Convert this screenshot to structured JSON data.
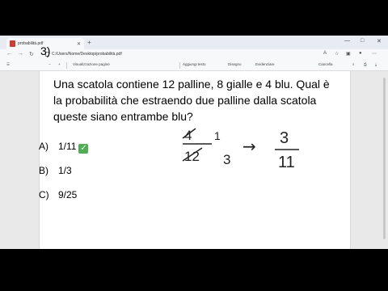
{
  "browser": {
    "tab_title": "probabilità.pdf",
    "url": "C:/Users/Nome/Desktop/probabilità.pdf",
    "window_controls": [
      "—",
      "□",
      "✕"
    ]
  },
  "pdf_toolbar": {
    "items": [
      "Visualizzazione pagine",
      "Aggiungi testo",
      "Disegno",
      "Evidenziare",
      "Cancella"
    ]
  },
  "question": {
    "number": "3)",
    "lines": [
      "Una scatola contiene 12 palline, 8 gialle e 4 blu. Qual è",
      "la probabilità che estraendo due palline dalla scatola",
      "queste siano entrambe blu?"
    ]
  },
  "options": [
    {
      "letter": "A)",
      "value": "1/11",
      "correct": true,
      "mark": "✓"
    },
    {
      "letter": "B)",
      "value": "1/3"
    },
    {
      "letter": "C)",
      "value": "9/25"
    }
  ],
  "handwriting": {
    "numerator_crossed": "4",
    "numerator_reduced": "1",
    "denominator_crossed": "12",
    "denominator_reduced": "3",
    "arrow": "→",
    "result_numerator": "3",
    "result_denominator": "11"
  },
  "colors": {
    "accent": "#0078d4",
    "check": "#4caf50",
    "pdf_icon": "#d23b2f"
  }
}
